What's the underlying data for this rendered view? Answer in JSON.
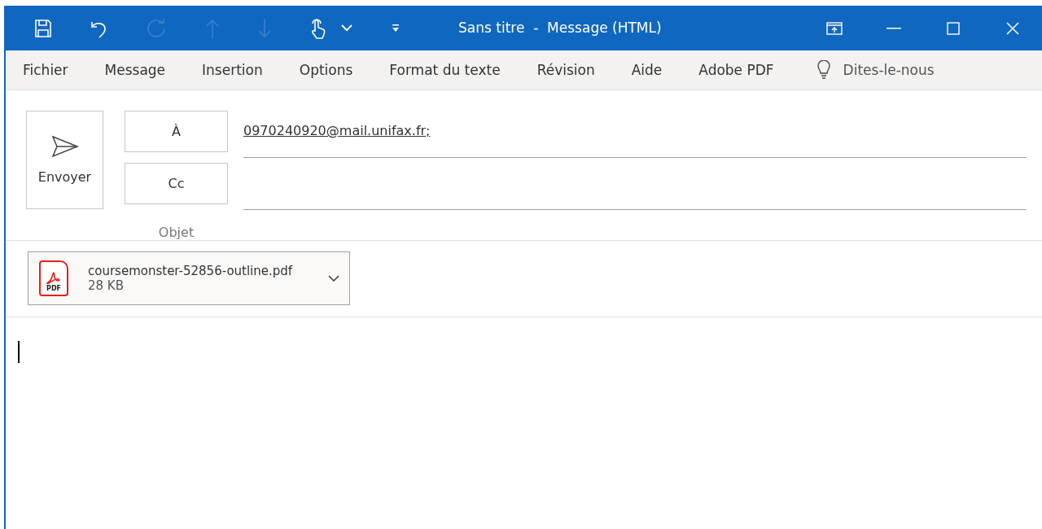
{
  "window": {
    "title": "Sans titre  -  Message (HTML)"
  },
  "quick_access": [
    {
      "kind": "save",
      "disabled": false
    },
    {
      "kind": "undo",
      "disabled": false
    },
    {
      "kind": "redo",
      "disabled": true
    },
    {
      "kind": "up",
      "disabled": true
    },
    {
      "kind": "down",
      "disabled": true
    },
    {
      "kind": "touch",
      "disabled": false
    },
    {
      "kind": "chevron",
      "disabled": false
    },
    {
      "kind": "customize",
      "disabled": false
    }
  ],
  "ribbon": {
    "tabs": [
      "Fichier",
      "Message",
      "Insertion",
      "Options",
      "Format du texte",
      "Révision",
      "Aide",
      "Adobe PDF"
    ],
    "tell_me": "Dites-le-nous"
  },
  "compose": {
    "send_label": "Envoyer",
    "to_label": "À",
    "to_value": "0970240920@mail.unifax.fr;",
    "cc_label": "Cc",
    "subject_label": "Objet"
  },
  "attachment": {
    "icon_text": "PDF",
    "name": "coursemonster-52856-outline.pdf",
    "size": "28 KB"
  }
}
